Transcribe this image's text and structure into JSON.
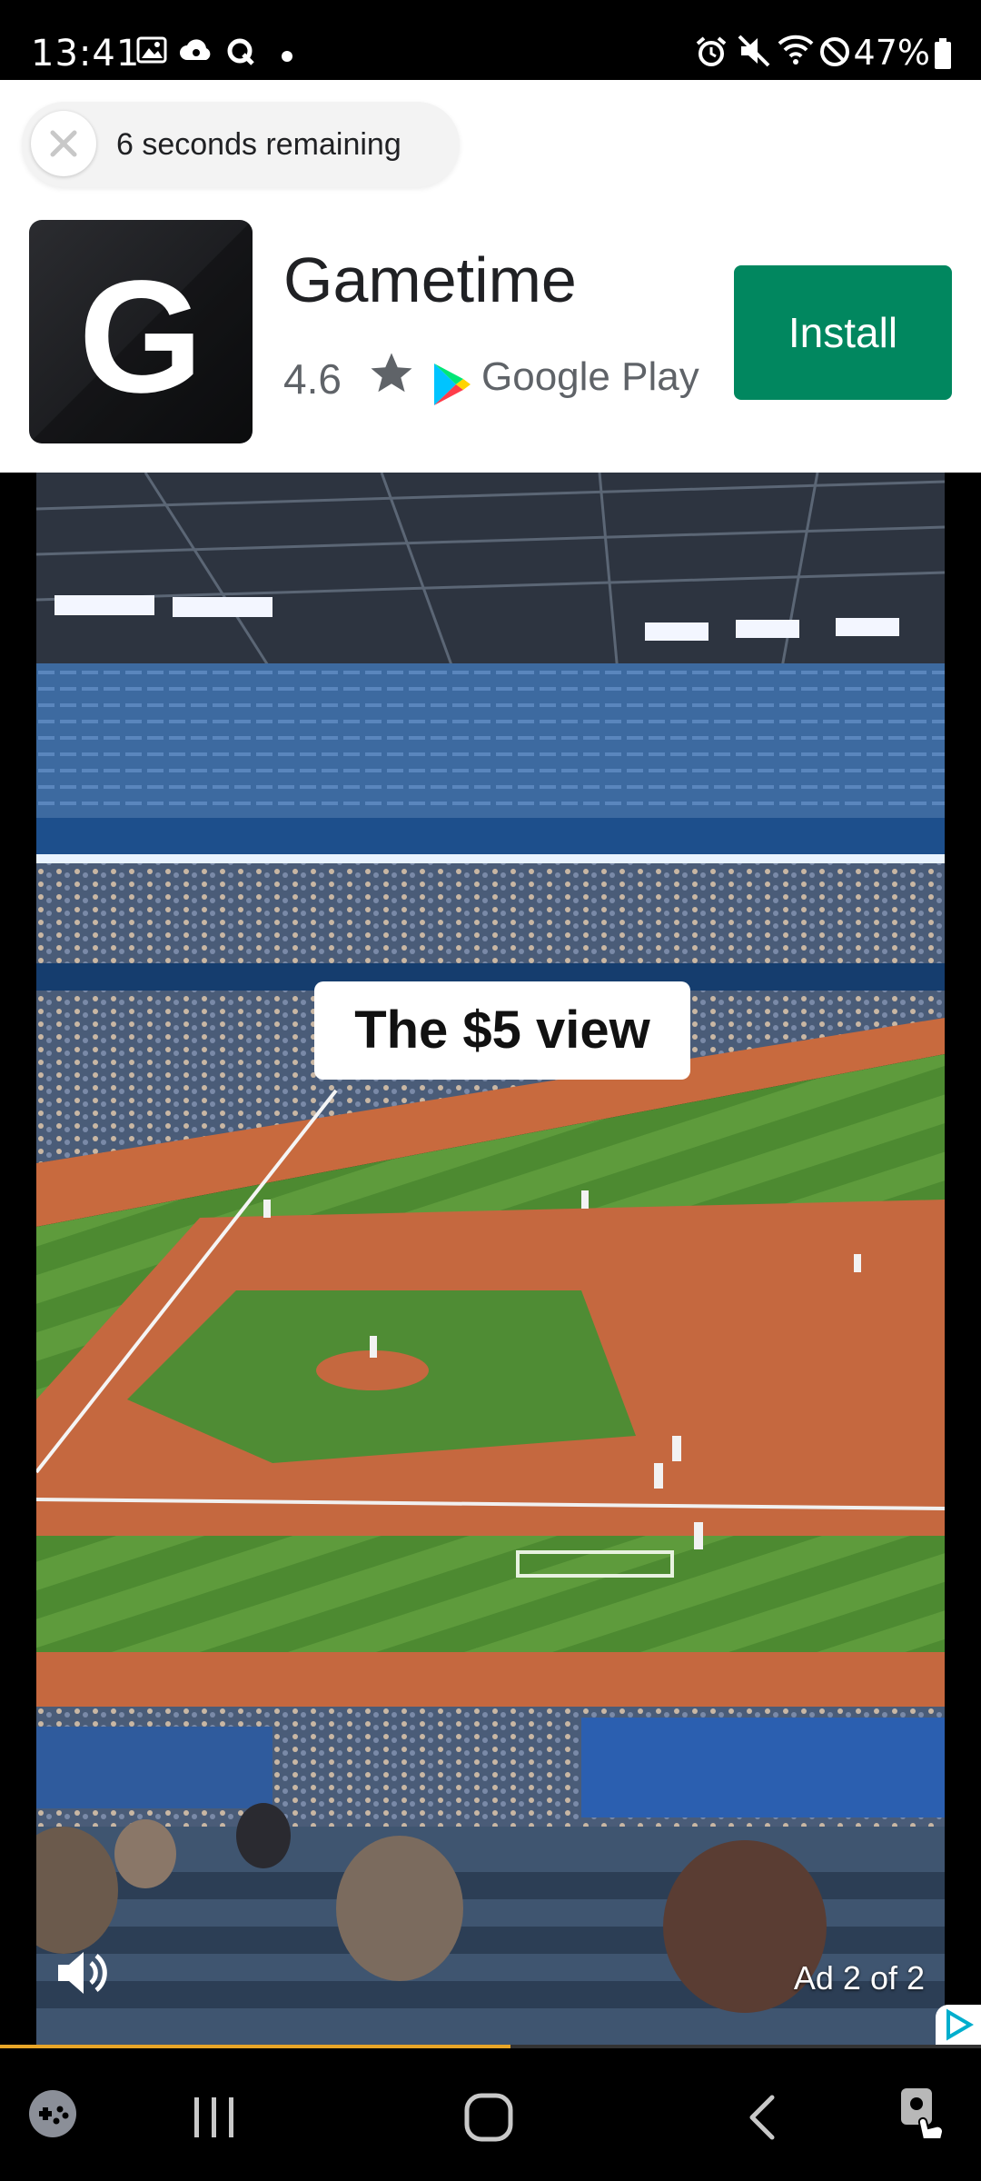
{
  "status_bar": {
    "time": "13:41",
    "battery": "47%",
    "notification_icons": [
      "gallery-icon",
      "cloud-icon",
      "q-icon",
      "dot-icon"
    ],
    "system_icons": [
      "alarm-icon",
      "mute-icon",
      "wifi-icon",
      "do-not-disturb-icon",
      "battery-icon"
    ]
  },
  "ad_header": {
    "countdown_text": "6 seconds remaining",
    "app_logo_letter": "G",
    "app_name": "Gametime",
    "rating": "4.6",
    "store_name": "Google Play",
    "install_label": "Install",
    "install_color": "#01875f"
  },
  "video": {
    "caption": "The $5 view",
    "ad_counter": "Ad 2 of 2",
    "progress_fraction": 0.52,
    "progress_color": "#e8a628"
  },
  "nav_bar": {
    "items": [
      "game-launcher-icon",
      "recent-apps-icon",
      "home-icon",
      "back-icon",
      "screen-touch-icon"
    ]
  }
}
